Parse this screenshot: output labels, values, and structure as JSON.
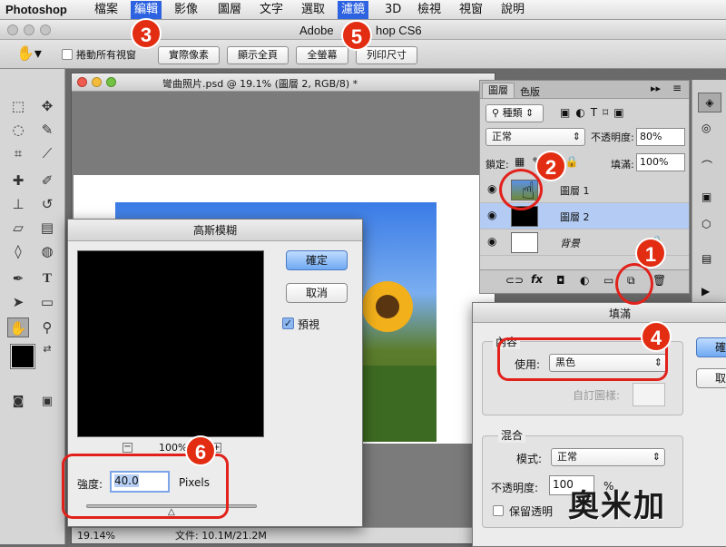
{
  "menubar": {
    "app": "Photoshop",
    "items": [
      {
        "label": "檔案"
      },
      {
        "label": "編輯"
      },
      {
        "label": "影像"
      },
      {
        "label": "圖層"
      },
      {
        "label": "文字"
      },
      {
        "label": "選取"
      },
      {
        "label": "濾鏡"
      },
      {
        "label": "3D"
      },
      {
        "label": "檢視"
      },
      {
        "label": "視窗"
      },
      {
        "label": "說明"
      }
    ]
  },
  "window_title": {
    "left": "Adobe",
    "right": "hop CS6"
  },
  "options_bar": {
    "scroll_all_label": "捲動所有視窗",
    "buttons": [
      "實際像素",
      "顯示全頁",
      "全螢幕",
      "列印尺寸"
    ]
  },
  "document": {
    "title": "彎曲照片.psd @ 19.1% (圖層 2, RGB/8) *",
    "zoom_status": "19.14%",
    "file_info": "文件: 10.1M/21.2M"
  },
  "gaussian_dialog": {
    "title": "高斯模糊",
    "ok_label": "確定",
    "cancel_label": "取消",
    "preview_label": "預視",
    "zoom_level": "100%",
    "radius_label": "強度:",
    "radius_value": "40.0",
    "radius_unit": "Pixels"
  },
  "layers_panel": {
    "tabs": [
      "圖層",
      "色版"
    ],
    "filter_kind": "種類",
    "blend_mode": "正常",
    "opacity_label": "不透明度:",
    "opacity_value": "80%",
    "lock_label": "鎖定:",
    "fill_label": "填滿:",
    "fill_value": "100%",
    "layers": [
      {
        "name": "圖層 1"
      },
      {
        "name": "圖層 2"
      },
      {
        "name": "背景"
      }
    ],
    "fx_label": "fx"
  },
  "fill_dialog": {
    "title": "填滿",
    "contents_group": "內容",
    "use_label": "使用:",
    "use_value": "黑色",
    "custom_pattern_label": "自訂圖樣:",
    "blending_group": "混合",
    "mode_label": "模式:",
    "mode_value": "正常",
    "opacity_label": "不透明度:",
    "opacity_value": "100",
    "opacity_unit": "%",
    "preserve_label": "保留透明",
    "ok_label": "確",
    "cancel_label": "取"
  },
  "annotations": [
    "1",
    "2",
    "3",
    "4",
    "5",
    "6"
  ],
  "watermark": "奧米加",
  "colors": {
    "accent": "#2d62e0",
    "badge": "#e22d12",
    "selected_layer": "#b4ccf4"
  }
}
